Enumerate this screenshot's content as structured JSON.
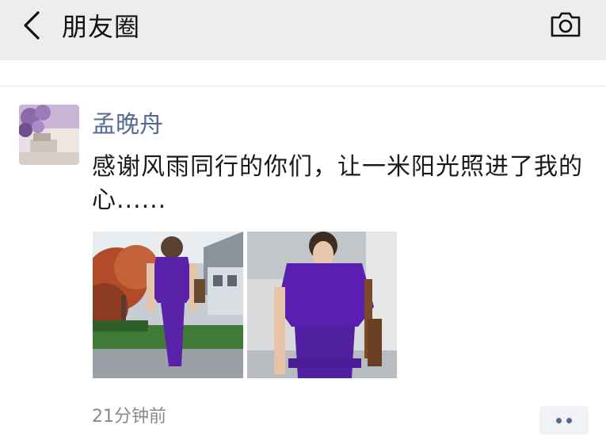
{
  "header": {
    "title": "朋友圈",
    "back_icon": "chevron-left-icon",
    "camera_icon": "camera-icon",
    "background": "#ededed"
  },
  "post": {
    "author": "孟晚舟",
    "text": "感谢风雨同行的你们，让一米阳光照进了我的心......",
    "time": "21分钟前",
    "name_color": "#576b95",
    "photos": [
      {
        "description": "photo-purple-dress-walking"
      },
      {
        "description": "photo-purple-dress-closeup"
      }
    ],
    "more_icon": "more-dots-icon"
  }
}
